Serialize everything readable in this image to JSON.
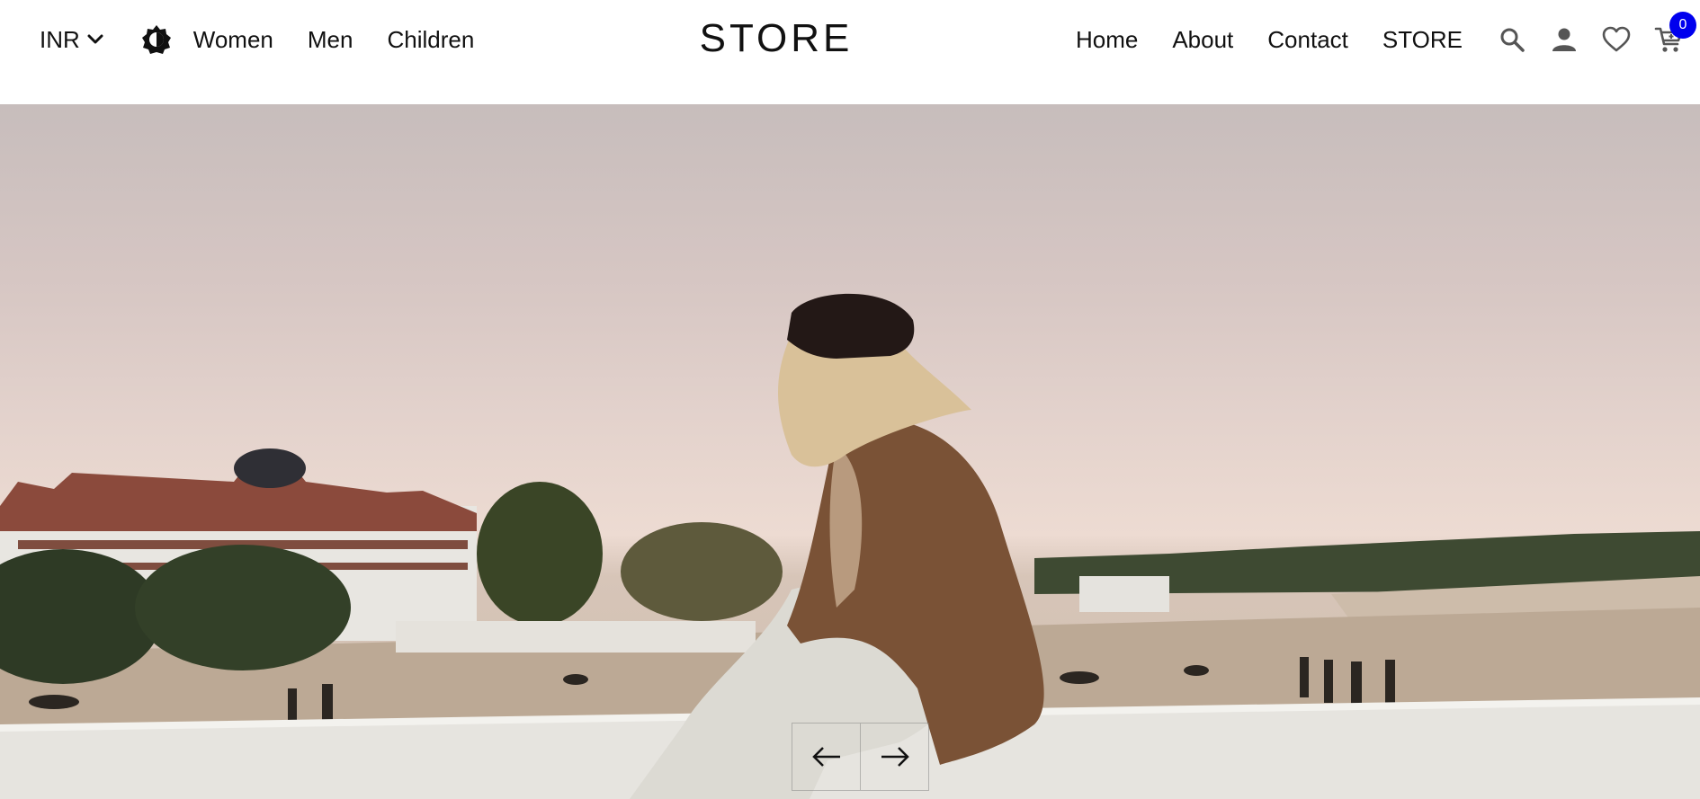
{
  "header": {
    "currency": "INR",
    "left_links": [
      {
        "label": "Women"
      },
      {
        "label": "Men"
      },
      {
        "label": "Children"
      }
    ],
    "logo": "STORE",
    "right_links": [
      {
        "label": "Home"
      },
      {
        "label": "About"
      },
      {
        "label": "Contact"
      },
      {
        "label": "STORE"
      }
    ],
    "icons": {
      "theme": "theme-toggle-icon",
      "search": "search-icon",
      "account": "user-icon",
      "wishlist": "heart-icon",
      "cart": "cart-icon"
    },
    "cart_count": "0",
    "badge_color": "#0000ee"
  },
  "hero": {
    "image": "woman-sitting-on-seaside-wall-photo",
    "prev_icon": "arrow-left-icon",
    "next_icon": "arrow-right-icon"
  }
}
